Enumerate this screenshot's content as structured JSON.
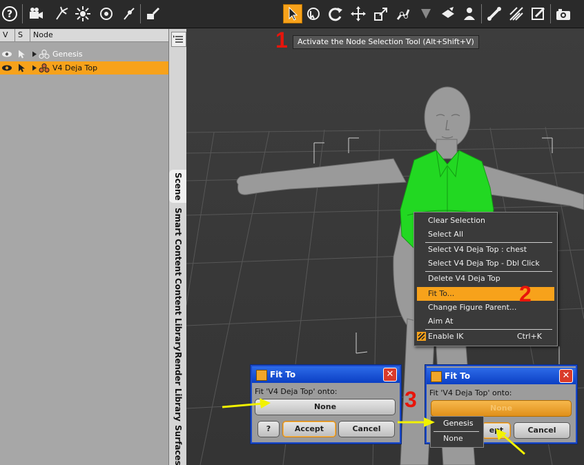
{
  "toolbar": {
    "icons": [
      "help-icon",
      "new-camera-icon",
      "spot-light-icon",
      "point-light-icon",
      "distant-light-icon",
      "light-icon",
      "scene-item-icon",
      "node-selection-tool-icon",
      "universal-tool-icon",
      "rotate-tool-icon",
      "translate-tool-icon",
      "scale-tool-icon",
      "joint-editor-icon",
      "surface-selection-icon",
      "geometry-editor-icon",
      "figure-editor-icon",
      "bone-tool-icon",
      "pose-tool-icon",
      "property-tool-icon",
      "render-icon"
    ],
    "active_tool": "node-selection-tool-icon",
    "accent_color": "#f7a21b"
  },
  "tooltip": "Activate the Node Selection Tool (Alt+Shift+V)",
  "annotations": {
    "one": "1",
    "two": "2",
    "three": "3"
  },
  "scene": {
    "columns": [
      "V",
      "S",
      "Node"
    ],
    "rows": [
      {
        "label": "Genesis",
        "selected": false
      },
      {
        "label": "V4 Deja Top",
        "selected": true
      }
    ]
  },
  "side_tabs": [
    "Scene",
    "Smart Content",
    "Content Library",
    "Render Library",
    "Surfaces"
  ],
  "context_menu": {
    "items": [
      {
        "label": "Clear Selection"
      },
      {
        "label": "Select All"
      },
      {
        "label": "Select V4 Deja Top : chest"
      },
      {
        "label": "Select V4 Deja Top - Dbl Click"
      },
      {
        "label": "Delete V4 Deja Top"
      },
      {
        "label": "Fit To..."
      },
      {
        "label": "Change Figure Parent..."
      },
      {
        "label": "Aim At"
      },
      {
        "label": "Enable IK",
        "shortcut": "Ctrl+K"
      }
    ],
    "highlighted": "Fit To..."
  },
  "dialog_left": {
    "title": "Fit To",
    "prompt": "Fit 'V4 Deja Top' onto:",
    "combo_value": "None",
    "help": "?",
    "accept": "Accept",
    "cancel": "Cancel",
    "close": "✕"
  },
  "dialog_right": {
    "title": "Fit To",
    "prompt": "Fit 'V4 Deja Top' onto:",
    "combo_value": "None",
    "accept_partial": "ept",
    "cancel": "Cancel",
    "close": "✕",
    "dropdown": [
      "Genesis",
      "None"
    ]
  },
  "colors": {
    "figure": "#9a9a9a",
    "clothing": "#22d822",
    "arrow": "#f2f200"
  }
}
